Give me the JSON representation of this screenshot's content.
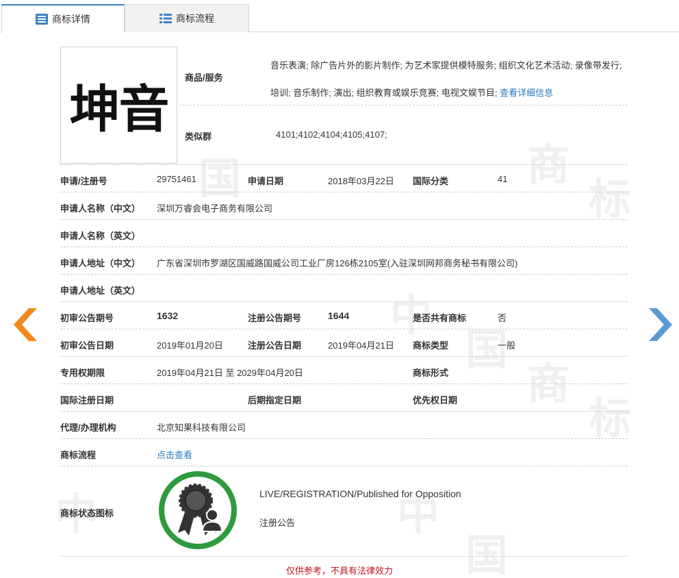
{
  "tabs": [
    {
      "label": "商标详情",
      "active": true,
      "icon": "list-icon"
    },
    {
      "label": "商标流程",
      "active": false,
      "icon": "grid-list-icon"
    }
  ],
  "watermark": [
    "中",
    "国",
    "商",
    "标"
  ],
  "logo": {
    "text": "坤音"
  },
  "goods": {
    "label": "商品/服务",
    "text": "音乐表演; 除广告片外的影片制作; 为艺术家提供模特服务; 组织文化艺术活动; 录像带发行; 培训; 音乐制作; 演出; 组织教育或娱乐竞赛; 电视文娱节目;",
    "more_link": "查看详细信息"
  },
  "similar_group": {
    "label": "类似群",
    "value": "4101;4102;4104;4105;4107;"
  },
  "fields": {
    "reg_no": {
      "label": "申请/注册号",
      "value": "29751461"
    },
    "apply_date": {
      "label": "申请日期",
      "value": "2018年03月22日"
    },
    "intl_class": {
      "label": "国际分类",
      "value": "41"
    },
    "applicant_cn": {
      "label": "申请人名称（中文）",
      "value": "深圳万睿会电子商务有限公司"
    },
    "applicant_en": {
      "label": "申请人名称（英文）",
      "value": ""
    },
    "address_cn": {
      "label": "申请人地址（中文）",
      "value": "广东省深圳市罗湖区国威路国威公司工业厂房126栋2105室(入驻深圳网邦商务秘书有限公司)"
    },
    "address_en": {
      "label": "申请人地址（英文）",
      "value": ""
    },
    "prelim_pub_no": {
      "label": "初审公告期号",
      "value": "1632"
    },
    "reg_pub_no": {
      "label": "注册公告期号",
      "value": "1644"
    },
    "shared": {
      "label": "是否共有商标",
      "value": "否"
    },
    "prelim_pub_date": {
      "label": "初审公告日期",
      "value": "2019年01月20日"
    },
    "reg_pub_date": {
      "label": "注册公告日期",
      "value": "2019年04月21日"
    },
    "mark_type": {
      "label": "商标类型",
      "value": "一般"
    },
    "exclusive_period": {
      "label": "专用权期限",
      "value": "2019年04月21日 至 2029年04月20日"
    },
    "mark_form": {
      "label": "商标形式",
      "value": ""
    },
    "intl_reg_date": {
      "label": "国际注册日期",
      "value": ""
    },
    "later_designation": {
      "label": "后期指定日期",
      "value": ""
    },
    "priority_date": {
      "label": "优先权日期",
      "value": ""
    },
    "agent": {
      "label": "代理/办理机构",
      "value": "北京知果科技有限公司"
    },
    "flow": {
      "label": "商标流程",
      "link": "点击查看"
    },
    "status_icon": {
      "label": "商标状态图标"
    }
  },
  "status": {
    "line1": "LIVE/REGISTRATION/Published for Opposition",
    "line2": "注册公告",
    "badge_color": "#2e9b3e"
  },
  "footer_note": "仅供参考，不具有法律效力",
  "colors": {
    "accent": "#3d7fc1",
    "link": "#2a7bbf",
    "arrow_left": "#f08a1c",
    "arrow_right": "#5b9bd5",
    "warning": "#c0141f"
  }
}
